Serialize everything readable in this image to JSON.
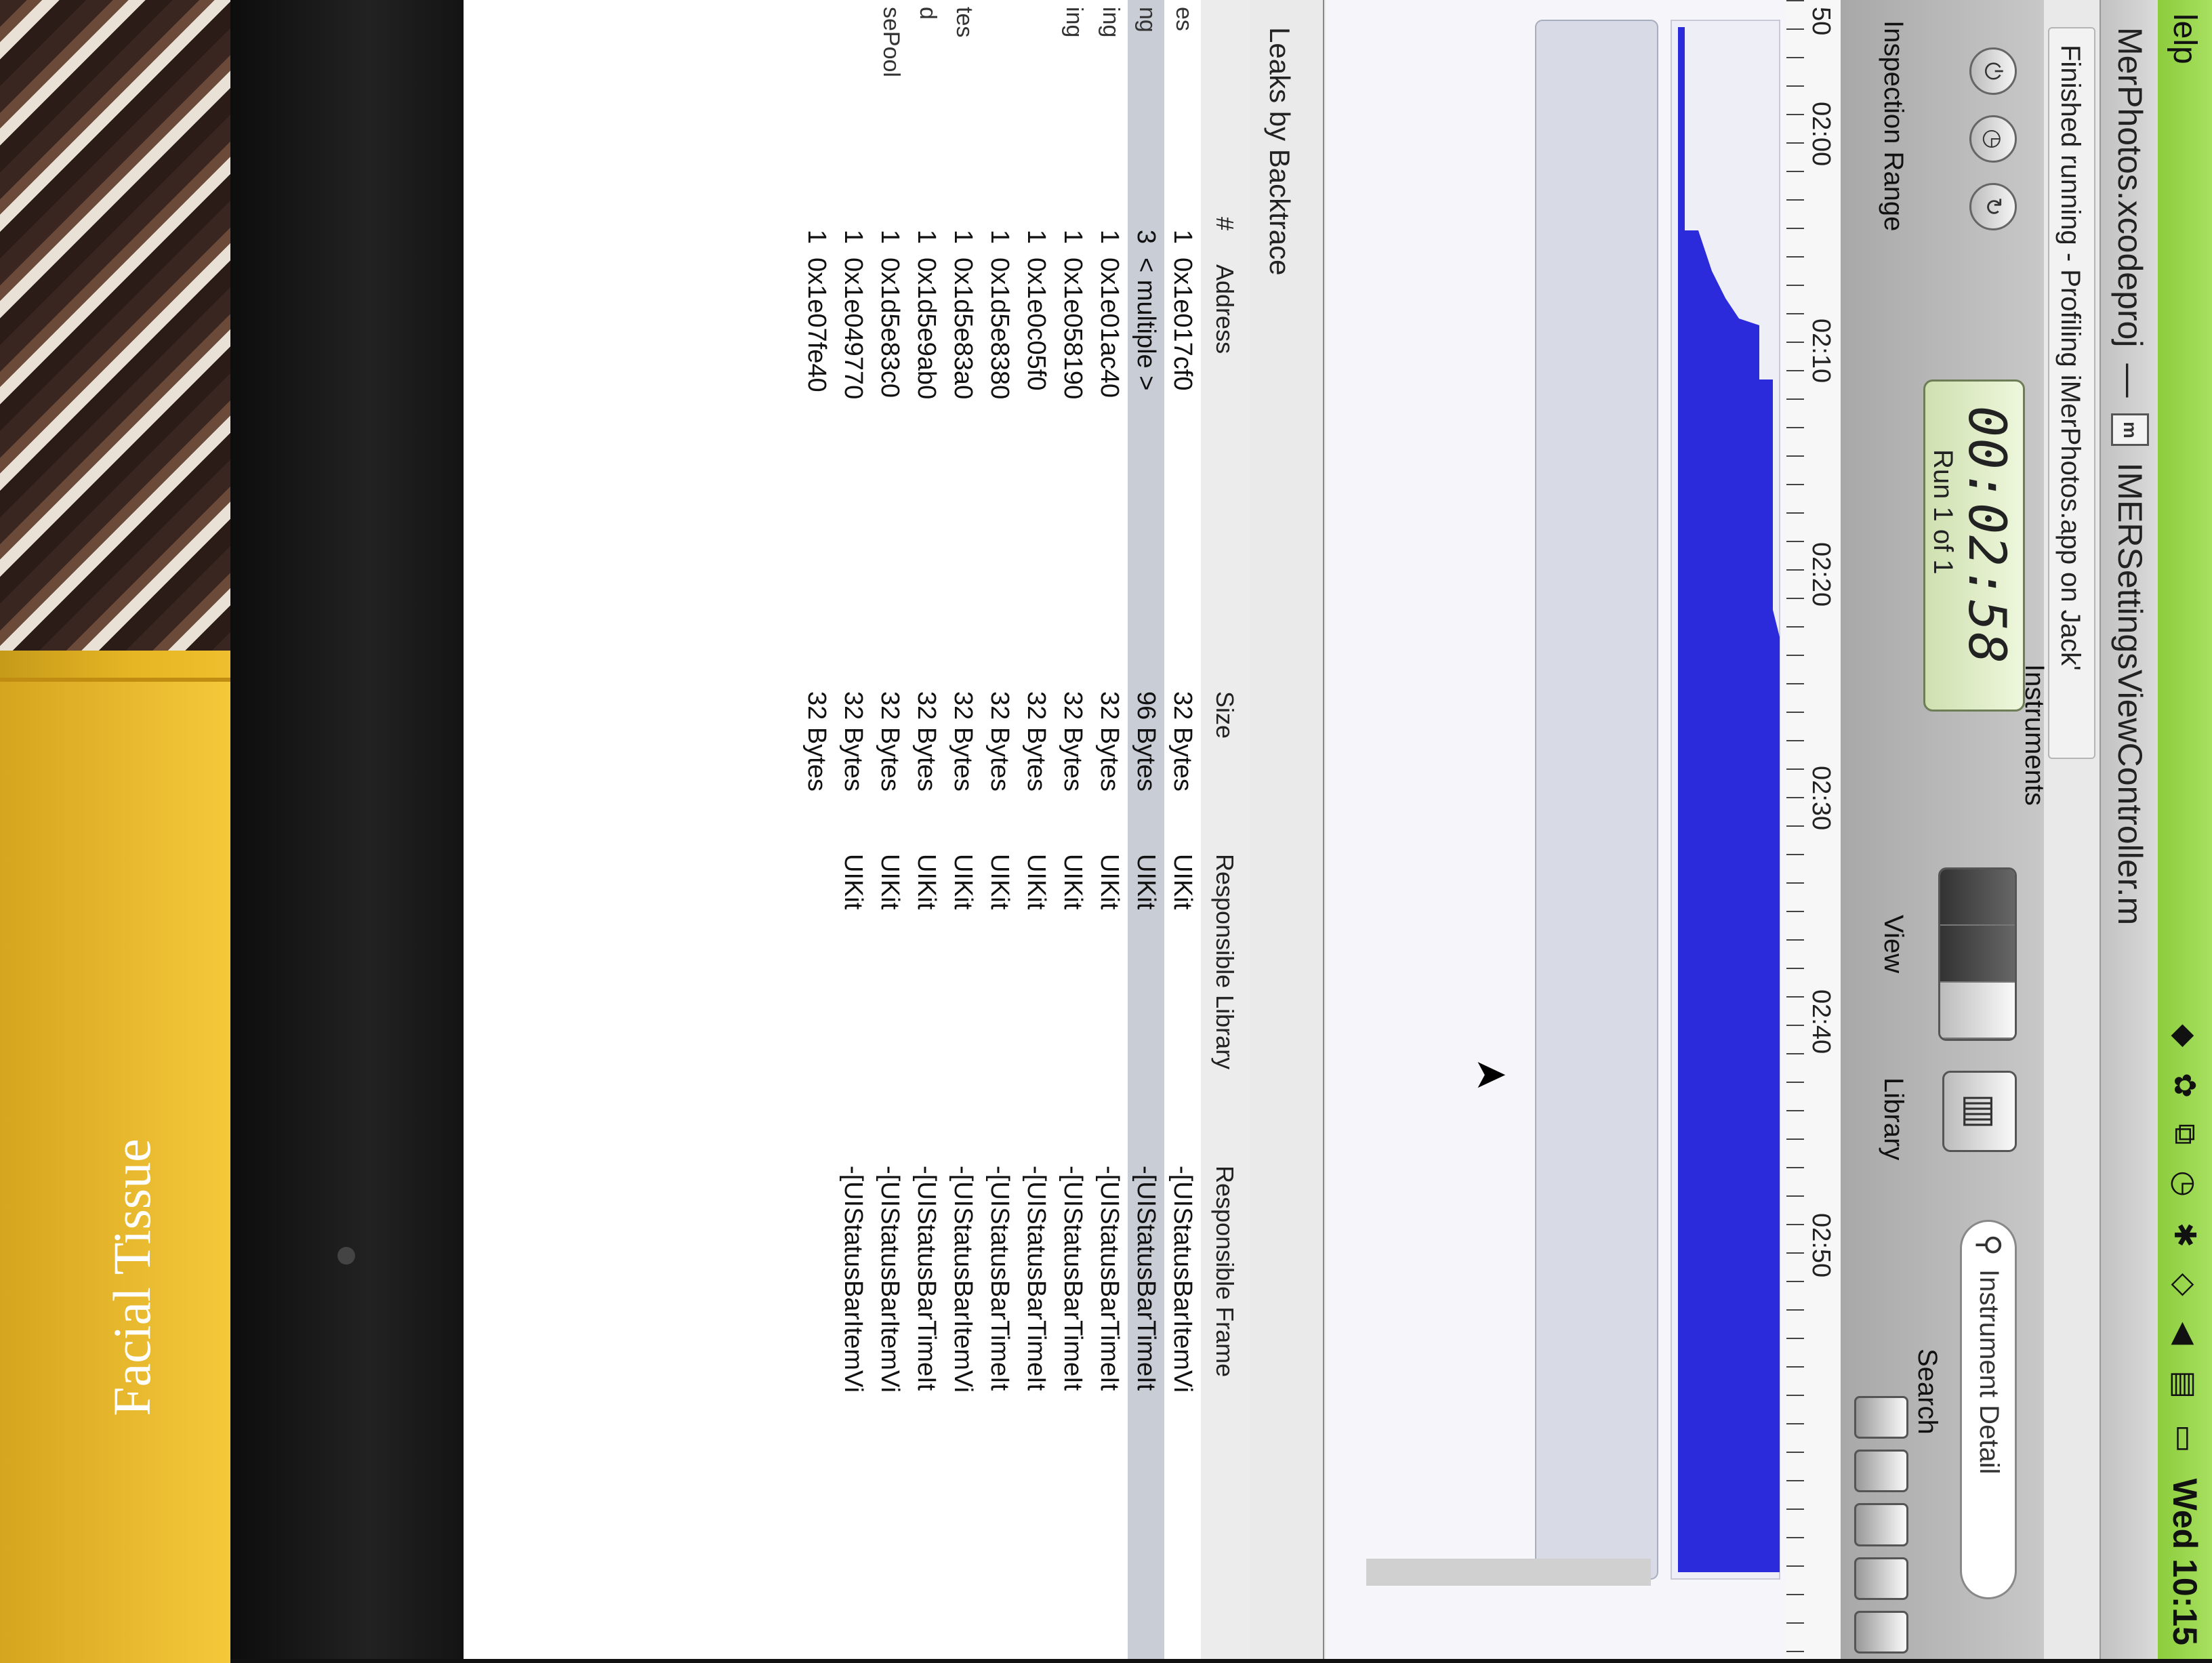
{
  "scene": {
    "tissue_label": "Facial Tissue"
  },
  "menubar": {
    "app_menu": "lelp",
    "clock": "Wed 10:15"
  },
  "window": {
    "project": "MerPhotos.xcodeproj",
    "separator": "—",
    "doc_icon_letter": "m",
    "file": "IMERSettingsViewController.m",
    "status": "Finished running - Profiling iMerPhotos.app on Jack'"
  },
  "toolbar": {
    "title": "Instruments",
    "inspection_range": "Inspection Range",
    "time": "00:02:58",
    "run": "Run 1 of 1",
    "view_label": "View",
    "library_label": "Library",
    "search_placeholder": "Instrument Detail",
    "search_label": "Search"
  },
  "timeline": {
    "ticks": [
      "50",
      "02:00",
      "02:10",
      "02:20",
      "02:30",
      "02:40",
      "02:50"
    ],
    "graph_color": "#2b2bdc"
  },
  "detail": {
    "title": "Leaks by Backtrace",
    "columns": [
      "#",
      "Address",
      "Size",
      "Responsible Library",
      "Responsible Frame"
    ],
    "side_items": [
      "es",
      "ng",
      "ing",
      "ing",
      "",
      "",
      "tes",
      "d",
      "sePool"
    ],
    "rows": [
      {
        "n": "1",
        "address": "0x1e017cf0",
        "size": "32 Bytes",
        "lib": "UIKit",
        "frame": "-[UIStatusBarItemVi"
      },
      {
        "n": "3",
        "address": "< multiple >",
        "size": "96 Bytes",
        "lib": "UIKit",
        "frame": "-[UIStatusBarTimeIt"
      },
      {
        "n": "1",
        "address": "0x1e01ac40",
        "size": "32 Bytes",
        "lib": "UIKit",
        "frame": "-[UIStatusBarTimeIt"
      },
      {
        "n": "1",
        "address": "0x1e058190",
        "size": "32 Bytes",
        "lib": "UIKit",
        "frame": "-[UIStatusBarTimeIt"
      },
      {
        "n": "1",
        "address": "0x1e0c05f0",
        "size": "32 Bytes",
        "lib": "UIKit",
        "frame": "-[UIStatusBarTimeIt"
      },
      {
        "n": "1",
        "address": "0x1d5e8380",
        "size": "32 Bytes",
        "lib": "UIKit",
        "frame": "-[UIStatusBarTimeIt"
      },
      {
        "n": "1",
        "address": "0x1d5e83a0",
        "size": "32 Bytes",
        "lib": "UIKit",
        "frame": "-[UIStatusBarItemVi"
      },
      {
        "n": "1",
        "address": "0x1d5e9ab0",
        "size": "32 Bytes",
        "lib": "UIKit",
        "frame": "-[UIStatusBarTimeIt"
      },
      {
        "n": "1",
        "address": "0x1d5e83c0",
        "size": "32 Bytes",
        "lib": "UIKit",
        "frame": "-[UIStatusBarItemVi"
      },
      {
        "n": "1",
        "address": "0x1e049770",
        "size": "32 Bytes",
        "lib": "UIKit",
        "frame": "-[UIStatusBarItemVi"
      },
      {
        "n": "1",
        "address": "0x1e07fe40",
        "size": "32 Bytes",
        "lib": "",
        "frame": ""
      }
    ]
  }
}
